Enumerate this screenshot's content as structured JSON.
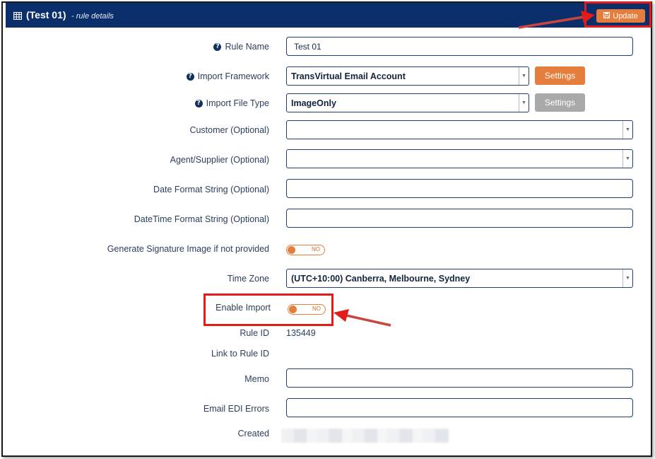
{
  "header": {
    "title": "(Test 01)",
    "subtitle": "- rule details",
    "update_label": "Update",
    "table_icon": "table-icon",
    "save_icon": "floppy-disk-icon"
  },
  "colors": {
    "header_bg": "#0b2f6b",
    "accent_orange": "#e57e3c",
    "disabled_gray": "#a9a9a9",
    "highlight_red": "#e21b1b"
  },
  "form": {
    "rule_name": {
      "label": "Rule Name",
      "value": "Test 01"
    },
    "import_framework": {
      "label": "Import Framework",
      "value": "TransVirtual Email Account",
      "settings_label": "Settings"
    },
    "import_file_type": {
      "label": "Import File Type",
      "value": "ImageOnly",
      "settings_label": "Settings"
    },
    "customer": {
      "label": "Customer (Optional)",
      "value": ""
    },
    "agent_supplier": {
      "label": "Agent/Supplier (Optional)",
      "value": ""
    },
    "date_format": {
      "label": "Date Format String (Optional)",
      "value": ""
    },
    "datetime_format": {
      "label": "DateTime Format String (Optional)",
      "value": ""
    },
    "generate_signature": {
      "label": "Generate Signature Image if not provided",
      "state": "NO"
    },
    "time_zone": {
      "label": "Time Zone",
      "value": "(UTC+10:00) Canberra, Melbourne, Sydney"
    },
    "enable_import": {
      "label": "Enable Import",
      "state": "NO"
    },
    "rule_id": {
      "label": "Rule ID",
      "value": "135449"
    },
    "link_to_rule_id": {
      "label": "Link to Rule ID",
      "value": ""
    },
    "memo": {
      "label": "Memo",
      "value": ""
    },
    "email_edi_errors": {
      "label": "Email EDI Errors",
      "value": ""
    },
    "created": {
      "label": "Created"
    }
  }
}
